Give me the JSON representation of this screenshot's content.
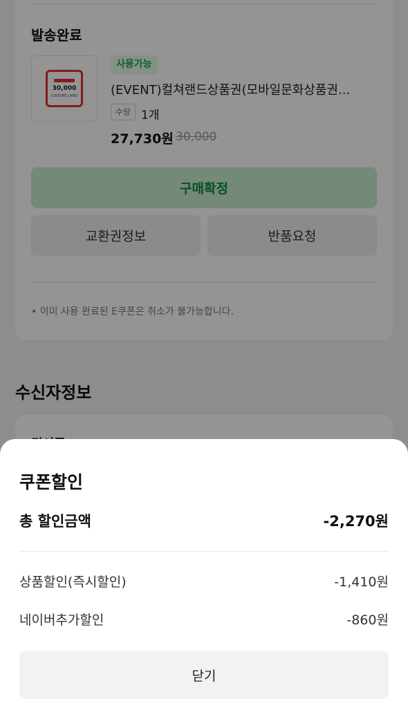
{
  "order": {
    "status_title": "발송완료",
    "product": {
      "badge": "사용가능",
      "name": "(EVENT)컬쳐랜드상품권(모바일문화상품권...",
      "qty_label": "수량",
      "qty_value": "1개",
      "price": "27,730원",
      "original_price": "30,000",
      "thumbnail": {
        "amount": "30,000",
        "brand": "CULTURE LAND"
      }
    },
    "buttons": {
      "confirm": "구매확정",
      "exchange_info": "교환권정보",
      "refund": "반품요청"
    },
    "notice": "• 이미 사용 완료된 E쿠폰은 취소가 불가능합니다."
  },
  "recipient": {
    "title": "수신자정보",
    "partial_label": "김서준"
  },
  "coupon_sheet": {
    "title": "쿠폰할인",
    "total_label": "총 할인금액",
    "total_value": "-2,270원",
    "items": [
      {
        "label": "상품할인(즉시할인)",
        "value": "-1,410원"
      },
      {
        "label": "네이버추가할인",
        "value": "-860원"
      }
    ],
    "close_label": "닫기"
  },
  "colors": {
    "accent_green": "#13a84c",
    "confirm_bg": "#c8eccf"
  }
}
